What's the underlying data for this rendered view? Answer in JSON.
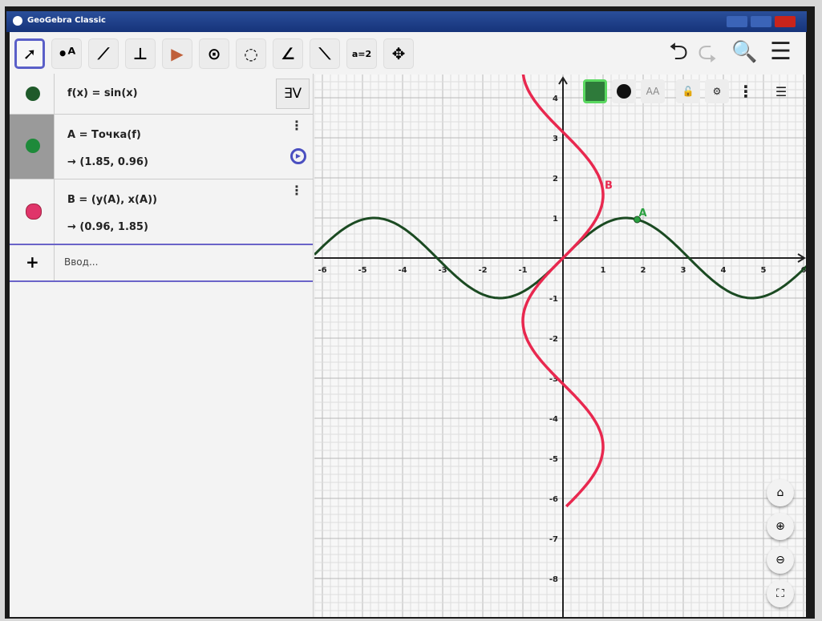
{
  "window": {
    "title": "GeoGebra Classic"
  },
  "toolbar": {
    "tools": [
      {
        "name": "move-tool",
        "glyph": "➚"
      },
      {
        "name": "point-tool",
        "glyph": "•ᴬ"
      },
      {
        "name": "line-tool",
        "glyph": "⟋"
      },
      {
        "name": "perpendicular-line-tool",
        "glyph": "⊥"
      },
      {
        "name": "polygon-tool",
        "glyph": "▶"
      },
      {
        "name": "circle-tool",
        "glyph": "⊙"
      },
      {
        "name": "ellipse-tool",
        "glyph": "◌"
      },
      {
        "name": "angle-tool",
        "glyph": "∠"
      },
      {
        "name": "reflect-tool",
        "glyph": "⟍"
      },
      {
        "name": "slider-tool",
        "glyph": "a=2"
      },
      {
        "name": "move-graphics-view-tool",
        "glyph": "✥"
      }
    ],
    "undo": "⮌",
    "redo": "⮎",
    "search": "🔍",
    "menu": "☰"
  },
  "algebra": {
    "toggle_label": "∃V",
    "items": [
      {
        "definition": "f(x) = sin(x)",
        "value": "",
        "color": "#1f5a2a"
      },
      {
        "definition": "A = Точка(f)",
        "value": "→  (1.85, 0.96)",
        "color": "#1e8a3a"
      },
      {
        "definition": "B = (y(A), x(A))",
        "value": "→  (0.96, 1.85)",
        "color": "#e0356a"
      }
    ],
    "input_placeholder": "Ввод...",
    "add_icon": "+"
  },
  "stylebar": {
    "label_style": "AA"
  },
  "graph": {
    "xrange": [
      -6.2,
      6.2
    ],
    "yrange": [
      -8.9,
      4.6
    ],
    "x_ticks": [
      "-6",
      "-5",
      "-4",
      "-3",
      "-2",
      "-1",
      "1",
      "2",
      "3",
      "4",
      "5",
      "6"
    ],
    "y_ticks": [
      "4",
      "3",
      "2",
      "1",
      "-1",
      "-2",
      "-3",
      "-4",
      "-5",
      "-6",
      "-7",
      "-8"
    ],
    "grid": true,
    "function_color": "#1b4a22",
    "locus_color": "#e8284f",
    "point_A": {
      "label": "A",
      "x": 1.85,
      "y": 0.96,
      "color": "#2aa040"
    },
    "point_B": {
      "label": "B",
      "x": 0.96,
      "y": 1.85,
      "color": "#e8284f"
    }
  }
}
